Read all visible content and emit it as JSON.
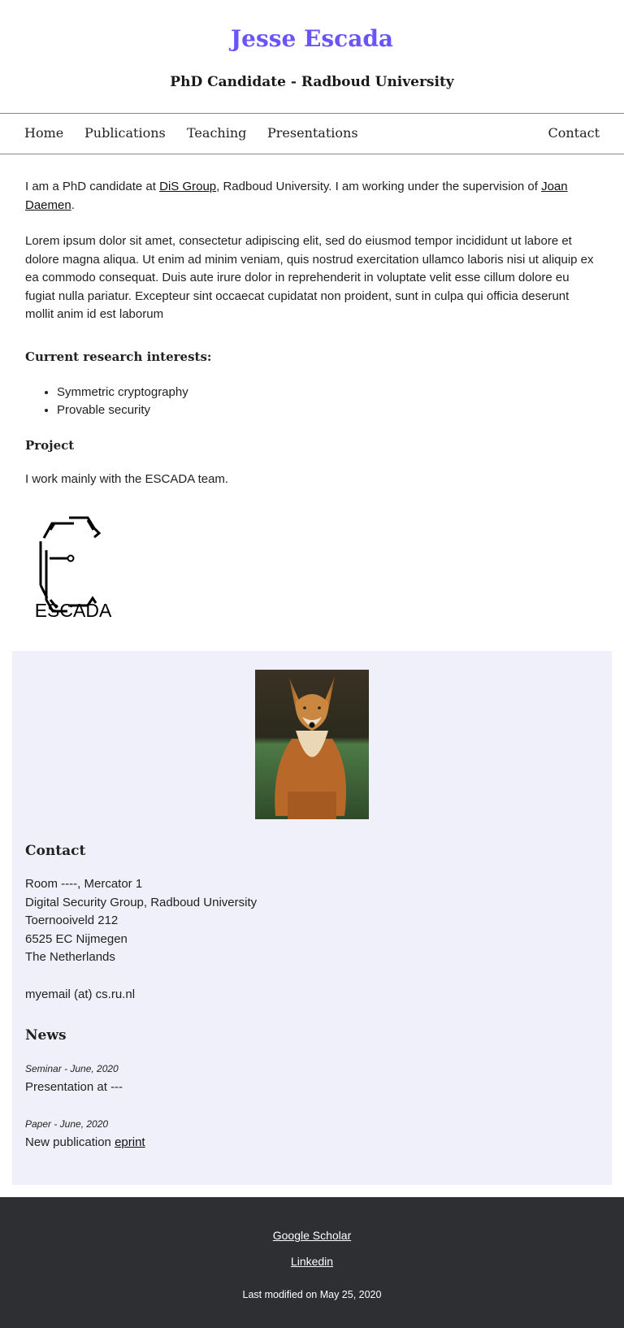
{
  "header": {
    "title": "Jesse Escada",
    "subtitle": "PhD Candidate - Radboud University"
  },
  "nav": {
    "items": [
      "Home",
      "Publications",
      "Teaching",
      "Presentations"
    ],
    "contact": "Contact"
  },
  "intro": {
    "t1": "I am a PhD candidate at ",
    "link1": "DiS Group",
    "t2": ", Radboud University. I am working under the supervision of ",
    "link2": "Joan Daemen",
    "t3": "."
  },
  "lorem": "Lorem ipsum dolor sit amet, consectetur adipiscing elit, sed do eiusmod tempor incididunt ut labore et dolore magna aliqua. Ut enim ad minim veniam, quis nostrud exercitation ullamco laboris nisi ut aliquip ex ea commodo consequat. Duis aute irure dolor in reprehenderit in voluptate velit esse cillum dolore eu fugiat nulla pariatur. Excepteur sint occaecat cupidatat non proident, sunt in culpa qui officia deserunt mollit anim id est laborum",
  "research": {
    "heading": "Current research interests:",
    "items": [
      "Symmetric cryptography",
      "Provable security"
    ]
  },
  "project": {
    "heading": "Project",
    "text": "I work mainly with the ESCADA team.",
    "logo_text": "ESCADA"
  },
  "contact": {
    "heading": "Contact",
    "address": [
      "Room ----, Mercator 1",
      "Digital Security Group, Radboud University",
      "Toernooiveld 212",
      "6525 EC Nijmegen",
      "The Netherlands"
    ],
    "email": "myemail (at) cs.ru.nl"
  },
  "news": {
    "heading": "News",
    "items": [
      {
        "meta": "Seminar - June, 2020",
        "text": "Presentation at ---",
        "link": ""
      },
      {
        "meta": "Paper - June, 2020",
        "text": "New publication ",
        "link": "eprint"
      }
    ]
  },
  "footer": {
    "links": [
      "Google Scholar",
      "Linkedin"
    ],
    "modified": "Last modified on May 25, 2020"
  },
  "colors": {
    "accent": "#6a55fb",
    "aside_bg": "#f0f0fa",
    "footer_bg": "#2e2f33"
  }
}
